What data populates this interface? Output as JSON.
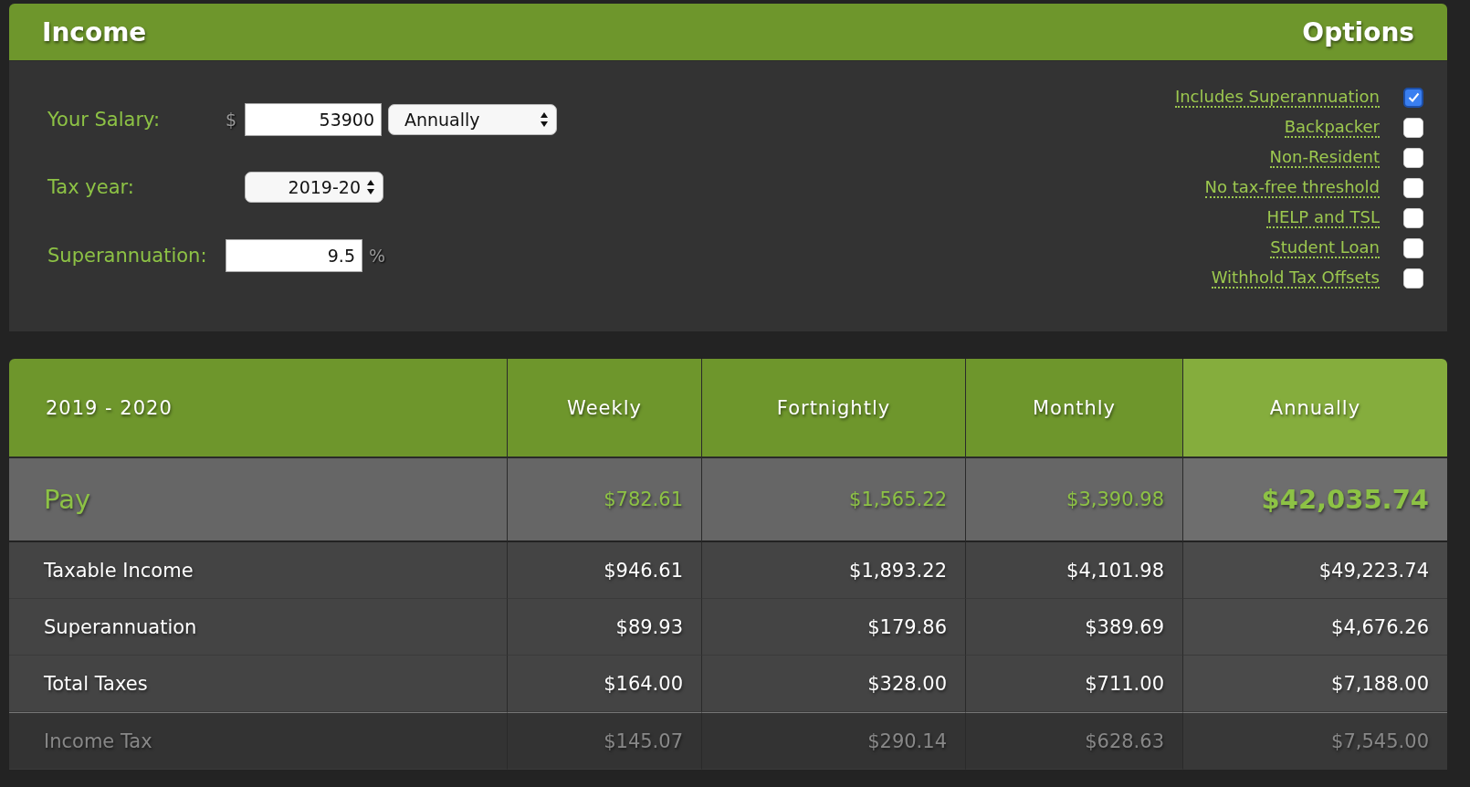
{
  "income": {
    "title": "Income",
    "salary": {
      "label": "Your Salary:",
      "currency": "$",
      "value": "53900",
      "period": "Annually"
    },
    "tax_year": {
      "label": "Tax year:",
      "value": "2019-20"
    },
    "super": {
      "label": "Superannuation:",
      "value": "9.5",
      "unit": "%"
    }
  },
  "options": {
    "title": "Options",
    "items": [
      {
        "label": "Includes Superannuation",
        "checked": true
      },
      {
        "label": "Backpacker",
        "checked": false
      },
      {
        "label": "Non-Resident",
        "checked": false
      },
      {
        "label": "No tax-free threshold",
        "checked": false
      },
      {
        "label": "HELP and TSL",
        "checked": false
      },
      {
        "label": "Student Loan",
        "checked": false
      },
      {
        "label": "Withhold Tax Offsets",
        "checked": false
      }
    ]
  },
  "table": {
    "title": "2019 - 2020",
    "columns": [
      {
        "label": "Weekly",
        "selected": false
      },
      {
        "label": "Fortnightly",
        "selected": false
      },
      {
        "label": "Monthly",
        "selected": false
      },
      {
        "label": "Annually",
        "selected": true
      }
    ],
    "rows": [
      {
        "kind": "pay",
        "label": "Pay",
        "values": [
          "$782.61",
          "$1,565.22",
          "$3,390.98",
          "$42,035.74"
        ]
      },
      {
        "kind": "main",
        "label": "Taxable Income",
        "values": [
          "$946.61",
          "$1,893.22",
          "$4,101.98",
          "$49,223.74"
        ]
      },
      {
        "kind": "main",
        "label": "Superannuation",
        "values": [
          "$89.93",
          "$179.86",
          "$389.69",
          "$4,676.26"
        ]
      },
      {
        "kind": "main",
        "label": "Total Taxes",
        "values": [
          "$164.00",
          "$328.00",
          "$711.00",
          "$7,188.00"
        ]
      },
      {
        "kind": "sub",
        "label": "Income Tax",
        "values": [
          "$145.07",
          "$290.14",
          "$628.63",
          "$7,545.00"
        ]
      }
    ]
  }
}
